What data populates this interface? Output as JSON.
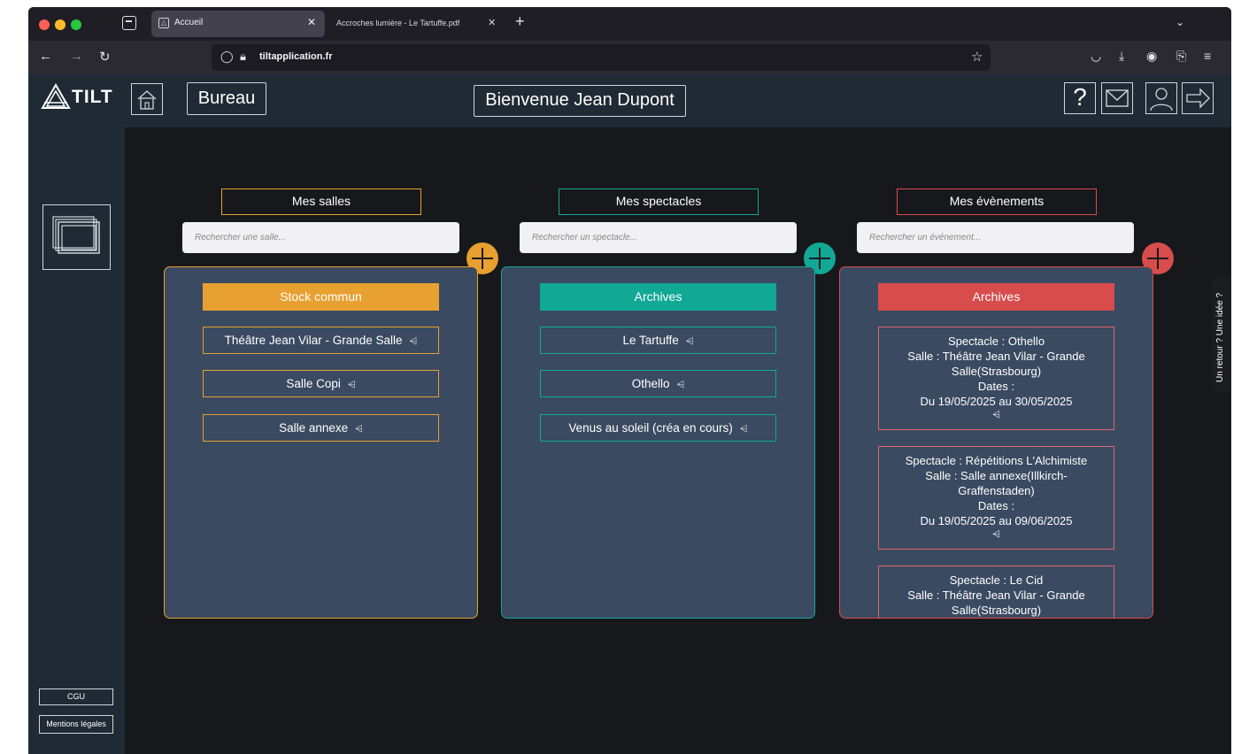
{
  "browser": {
    "tabs": [
      {
        "label": "Accueil",
        "active": true
      },
      {
        "label": "Accroches lumière - Le Tartuffe.pdf",
        "active": false
      }
    ],
    "url": "tiltapplication.fr"
  },
  "header": {
    "logo": "TILT",
    "bureau_label": "Bureau",
    "welcome": "Bienvenue Jean Dupont",
    "help_label": "?"
  },
  "sidebar": {
    "cgu": "CGU",
    "legal": "Mentions légales"
  },
  "columns": {
    "salles": {
      "title": "Mes salles",
      "search_placeholder": "Rechercher une salle...",
      "header": "Stock commun",
      "items": [
        "Théâtre Jean Vilar - Grande Salle",
        "Salle Copi",
        "Salle annexe"
      ]
    },
    "spectacles": {
      "title": "Mes spectacles",
      "search_placeholder": "Rechercher un spectacle...",
      "header": "Archives",
      "items": [
        "Le Tartuffe",
        "Othello",
        "Venus au soleil (créa en cours)"
      ]
    },
    "evenements": {
      "title": "Mes évènements",
      "search_placeholder": "Rechercher un événement...",
      "header": "Archives",
      "events": [
        {
          "spectacle": "Spectacle : Othello",
          "salle_1": "Salle : Théâtre Jean Vilar - Grande",
          "salle_2": "Salle(Strasbourg)",
          "dates_label": "Dates :",
          "dates": "Du 19/05/2025 au 30/05/2025"
        },
        {
          "spectacle": "Spectacle : Répétitions L'Alchimiste",
          "salle_1": "Salle : Salle annexe(Illkirch-",
          "salle_2": "Graffenstaden)",
          "dates_label": "Dates :",
          "dates": "Du 19/05/2025 au 09/06/2025"
        },
        {
          "spectacle": "Spectacle : Le Cid",
          "salle_1": "Salle : Théâtre Jean Vilar - Grande",
          "salle_2": "Salle(Strasbourg)"
        }
      ]
    }
  },
  "feedback": "Un retour ? Une idée ?",
  "colors": {
    "salles": "#e8a030",
    "spectacles": "#12a896",
    "evenements": "#d84c4c"
  }
}
